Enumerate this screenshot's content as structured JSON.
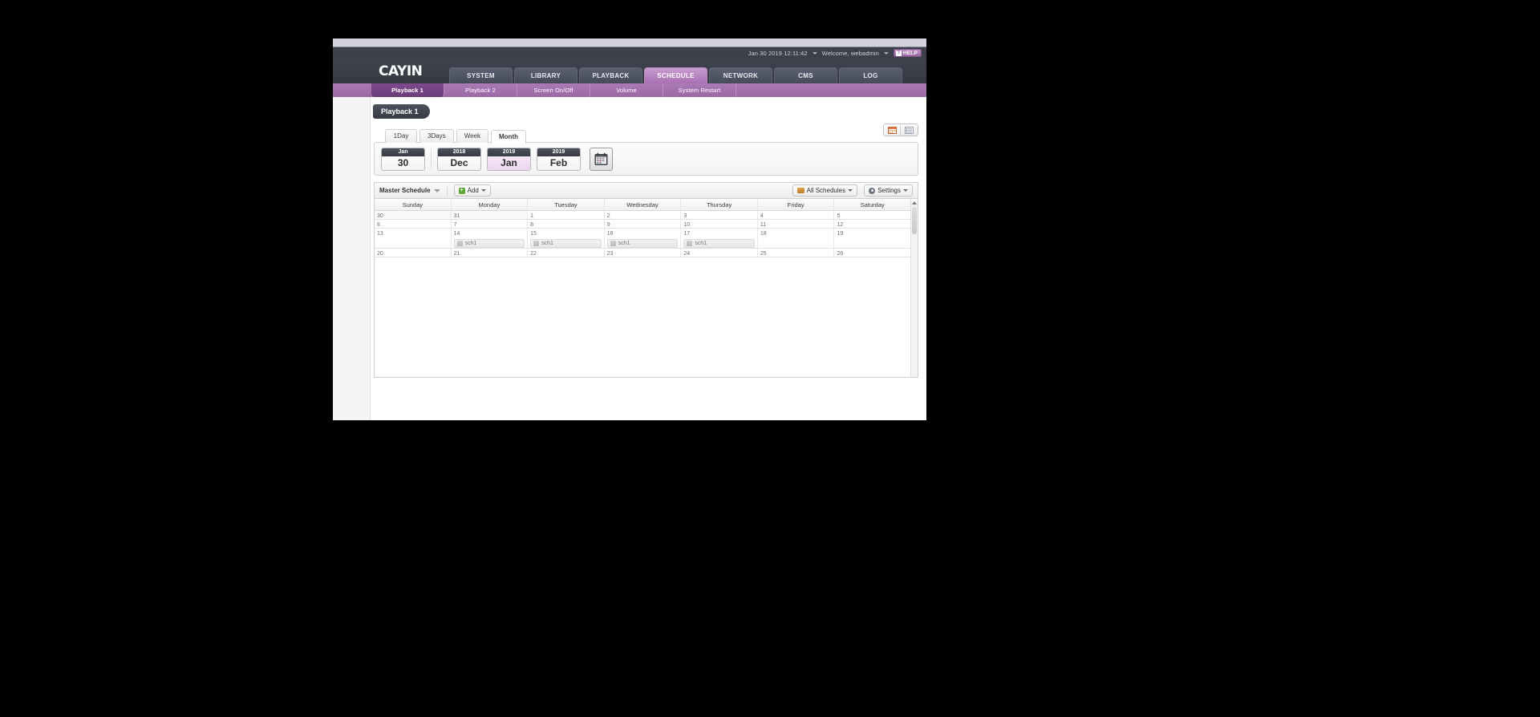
{
  "statusbar": {
    "timestamp": "Jan 30 2019 12:11:42",
    "welcome": "Welcome, webadmin",
    "help_label": "HELP",
    "help_glyph": "?"
  },
  "header": {
    "logo": "CAYIN",
    "nav": [
      {
        "label": "SYSTEM",
        "active": false
      },
      {
        "label": "LIBRARY",
        "active": false
      },
      {
        "label": "PLAYBACK",
        "active": false
      },
      {
        "label": "SCHEDULE",
        "active": true
      },
      {
        "label": "NETWORK",
        "active": false
      },
      {
        "label": "CMS",
        "active": false
      },
      {
        "label": "LOG",
        "active": false
      }
    ]
  },
  "subnav": [
    {
      "label": "Playback 1",
      "active": true
    },
    {
      "label": "Playback 2",
      "active": false
    },
    {
      "label": "Screen On/Off",
      "active": false
    },
    {
      "label": "Volume",
      "active": false
    },
    {
      "label": "System Restart",
      "active": false
    }
  ],
  "page": {
    "title": "Playback 1"
  },
  "viewtabs": [
    {
      "label": "1Day",
      "active": false
    },
    {
      "label": "3Days",
      "active": false
    },
    {
      "label": "Week",
      "active": false
    },
    {
      "label": "Month",
      "active": true
    }
  ],
  "dateselector": [
    {
      "top": "Jan",
      "bottom": "30",
      "selected": false
    },
    {
      "top": "2018",
      "bottom": "Dec",
      "selected": false
    },
    {
      "top": "2019",
      "bottom": "Jan",
      "selected": true
    },
    {
      "top": "2019",
      "bottom": "Feb",
      "selected": false
    }
  ],
  "toolbar": {
    "schedule_label": "Master Schedule",
    "add_label": "Add",
    "all_schedules_label": "All Schedules",
    "settings_label": "Settings"
  },
  "calendar": {
    "dow": [
      "Sunday",
      "Monday",
      "Tuesday",
      "Wednesday",
      "Thursday",
      "Friday",
      "Saturday"
    ],
    "weeks": [
      [
        {
          "num": "30",
          "other": true,
          "events": []
        },
        {
          "num": "31",
          "other": true,
          "events": []
        },
        {
          "num": "1",
          "other": false,
          "events": []
        },
        {
          "num": "2",
          "other": false,
          "events": []
        },
        {
          "num": "3",
          "other": false,
          "events": []
        },
        {
          "num": "4",
          "other": false,
          "events": []
        },
        {
          "num": "5",
          "other": false,
          "events": []
        }
      ],
      [
        {
          "num": "6",
          "other": false,
          "events": []
        },
        {
          "num": "7",
          "other": false,
          "events": []
        },
        {
          "num": "8",
          "other": false,
          "events": []
        },
        {
          "num": "9",
          "other": false,
          "events": []
        },
        {
          "num": "10",
          "other": false,
          "events": []
        },
        {
          "num": "11",
          "other": false,
          "events": []
        },
        {
          "num": "12",
          "other": false,
          "events": []
        }
      ],
      [
        {
          "num": "13",
          "other": false,
          "events": []
        },
        {
          "num": "14",
          "other": false,
          "events": [
            "sch1"
          ]
        },
        {
          "num": "15",
          "other": false,
          "events": [
            "sch1"
          ]
        },
        {
          "num": "16",
          "other": false,
          "events": [
            "sch1"
          ]
        },
        {
          "num": "17",
          "other": false,
          "events": [
            "sch1"
          ]
        },
        {
          "num": "18",
          "other": false,
          "events": []
        },
        {
          "num": "19",
          "other": false,
          "events": []
        }
      ],
      [
        {
          "num": "20",
          "other": false,
          "events": []
        },
        {
          "num": "21",
          "other": false,
          "events": []
        },
        {
          "num": "22",
          "other": false,
          "events": []
        },
        {
          "num": "23",
          "other": false,
          "events": []
        },
        {
          "num": "24",
          "other": false,
          "events": []
        },
        {
          "num": "25",
          "other": false,
          "events": []
        },
        {
          "num": "26",
          "other": false,
          "events": []
        }
      ]
    ]
  }
}
